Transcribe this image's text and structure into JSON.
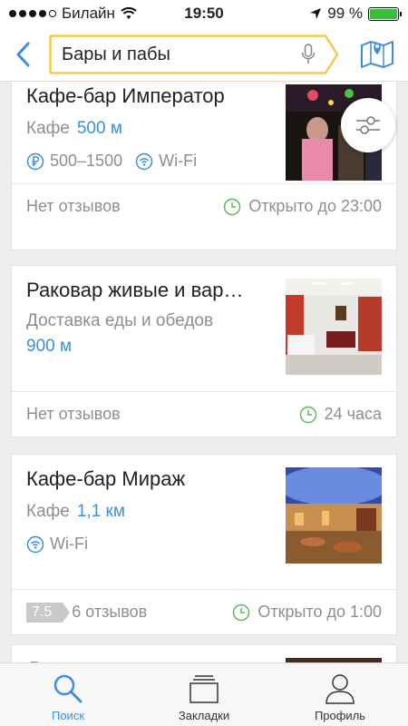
{
  "status_bar": {
    "carrier": "Билайн",
    "time": "19:50",
    "battery": "99 %",
    "battery_level": 0.99
  },
  "header": {
    "search_value": "Бары и пабы"
  },
  "cards": [
    {
      "title": "Кафе-бар Император",
      "category": "Кафе",
      "distance": "500 м",
      "price": "500–1500",
      "wifi": "Wi-Fi",
      "reviews": "Нет отзывов",
      "hours": "Открыто до 23:00"
    },
    {
      "title": "Раковар живые и вар…",
      "category": "Доставка еды и обедов",
      "distance": "900 м",
      "reviews": "Нет отзывов",
      "hours": "24 часа"
    },
    {
      "title": "Кафе-бар Мираж",
      "category": "Кафе",
      "distance": "1,1 км",
      "wifi": "Wi-Fi",
      "rating": "7.5",
      "reviews": "6 отзывов",
      "hours": "Открыто до 1:00"
    },
    {
      "title": "Д"
    }
  ],
  "tabs": [
    {
      "label": "Поиск",
      "icon": "search-icon"
    },
    {
      "label": "Закладки",
      "icon": "bookmarks-icon"
    },
    {
      "label": "Профиль",
      "icon": "profile-icon"
    }
  ],
  "colors": {
    "accent": "#3b8fdc",
    "search_border": "#f2c94c",
    "open_green": "#5cb85c"
  }
}
